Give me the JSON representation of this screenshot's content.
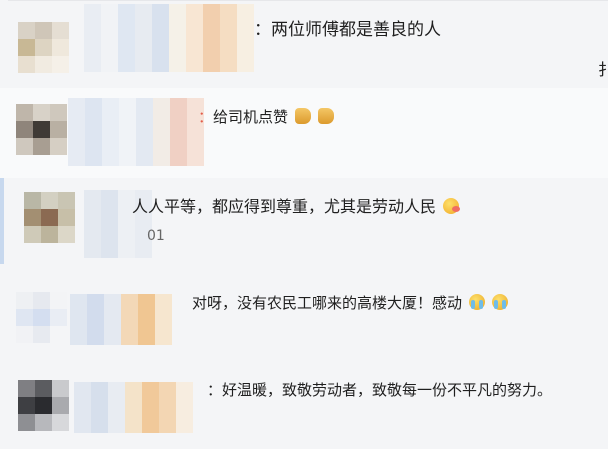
{
  "comments": [
    {
      "prefix": "：",
      "text": "两位师傅都是善良的人",
      "emoji": []
    },
    {
      "prefix": "：",
      "text": "给司机点赞",
      "emoji": [
        "thumbs-up",
        "thumbs-up"
      ]
    },
    {
      "prefix": "",
      "text": "人人平等，都应得到尊重，尤其是劳动人民",
      "emoji": [
        "face-blowing-kiss"
      ]
    },
    {
      "prefix": "",
      "text": "对呀，没有农民工哪来的高楼大厦！感动",
      "emoji": [
        "loudly-crying-face",
        "loudly-crying-face"
      ]
    },
    {
      "prefix": "：",
      "text": "好温暖，致敬劳动者，致敬每一份不平凡的努力。",
      "emoji": []
    }
  ],
  "partial_text": {
    "edge_char": "扌",
    "time_digits": "01"
  },
  "colors": {
    "band": "#f4f5f7",
    "text": "#1f1f1f",
    "accent": "#c7d8ee"
  }
}
